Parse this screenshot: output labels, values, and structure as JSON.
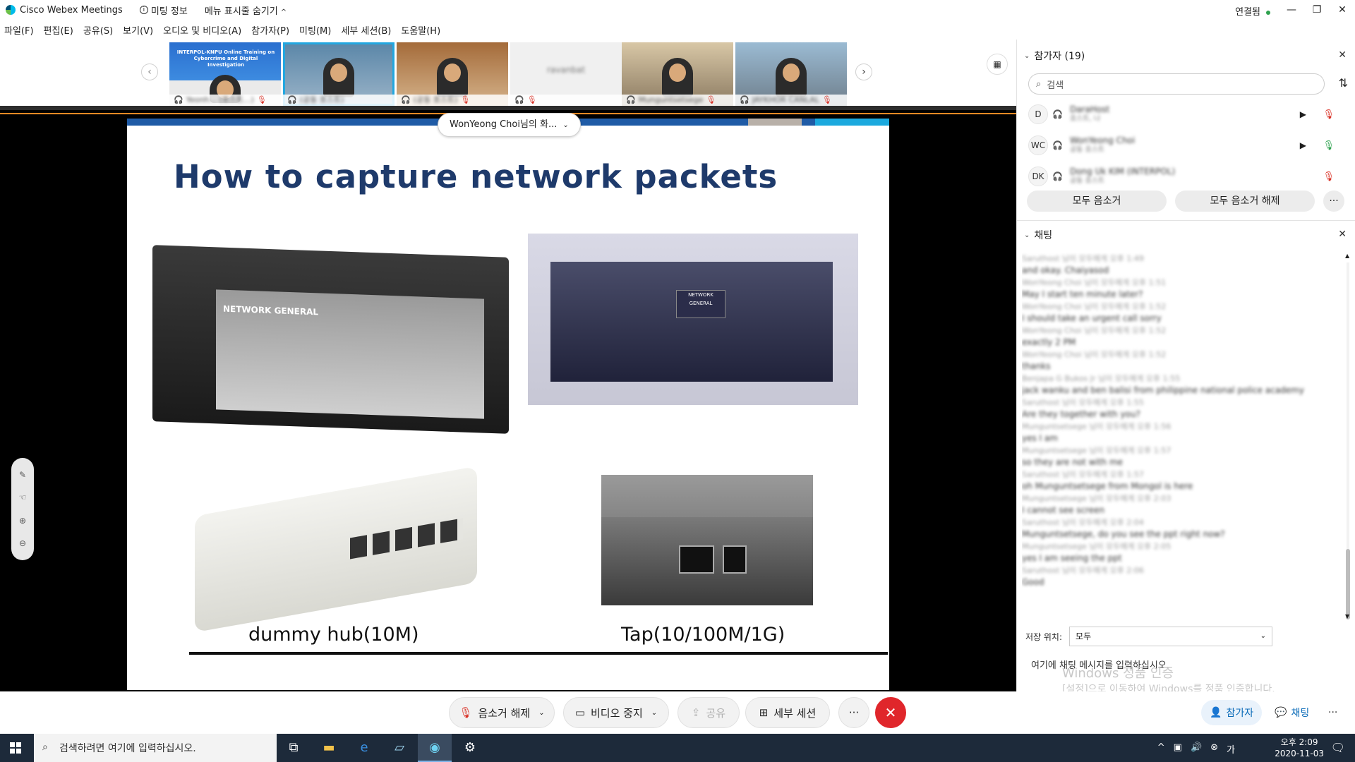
{
  "window": {
    "app_title": "Cisco Webex Meetings",
    "meeting_info": "미팅 정보",
    "hide_menu": "메뉴 표시줄 숨기기",
    "connection": "연결됨",
    "controls": {
      "minimize": "—",
      "restore": "❐",
      "close": "✕"
    }
  },
  "menu": {
    "items": [
      "파일(F)",
      "편집(E)",
      "공유(S)",
      "보기(V)",
      "오디오 및 비디오(A)",
      "참가자(P)",
      "미팅(M)",
      "세부 세션(B)",
      "도움말(H)"
    ]
  },
  "thumbnails": [
    {
      "label": "Yeonh... (호스트...)",
      "banner": "INTERPOL-KNPU Online Training on Cybercrime and Digital Investigation"
    },
    {
      "label": "(공동 호스트)"
    },
    {
      "label": "(공동 호스트)"
    },
    {
      "label": "ravanbat"
    },
    {
      "label": "Munguntsetsege"
    },
    {
      "label": "JAYKHOR CANLAL"
    }
  ],
  "share": {
    "presenter": "WonYeong Choi님의 화...",
    "slide": {
      "title": "How to capture network packets",
      "device1_brand": "NETWORK GENERAL",
      "device2_brand": "NETWORK GENERAL",
      "caption_left": "dummy hub(10M)",
      "caption_right": "Tap(10/100M/1G)"
    }
  },
  "toolbar": {
    "mute": "음소거 해제",
    "video": "비디오 중지",
    "share": "공유",
    "breakout": "세부 세션",
    "more": "···",
    "end": "✕",
    "participants": "참가자",
    "chat": "채팅",
    "panel_more": "···"
  },
  "participants_panel": {
    "title": "참가자 (19)",
    "search_placeholder": "검색",
    "rows": [
      {
        "initials": "D",
        "name": "DaraHost",
        "role": "호스트, 나"
      },
      {
        "initials": "WC",
        "name": "WonYeong Choi",
        "role": "공동 호스트"
      },
      {
        "initials": "DK",
        "name": "Dong Uk KIM (INTERPOL)",
        "role": "공동 호스트"
      }
    ],
    "mute_all": "모두 음소거",
    "unmute_all": "모두 음소거 해제",
    "more": "···"
  },
  "chat_panel": {
    "title": "채팅",
    "lines": [
      {
        "meta": "Saruthost 님이 모두에게 오후 1:49"
      },
      {
        "text": "and okay. Chaiyasod"
      },
      {
        "meta": "WonYeong Choi 님이 모두에게 오후 1:51"
      },
      {
        "text": "May I start ten minute later?"
      },
      {
        "meta": "WonYeong Choi 님이 모두에게 오후 1:52"
      },
      {
        "text": "I should take an urgent call sorry"
      },
      {
        "meta": "WonYeong Choi 님이 모두에게 오후 1:52"
      },
      {
        "text": "exactly 2 PM"
      },
      {
        "meta": "WonYeong Choi 님이 모두에게 오후 1:52"
      },
      {
        "text": "thanks"
      },
      {
        "meta": "Benjapa G Bukos Jr 님이 모두에게 오후 1:55"
      },
      {
        "text": "jack wanku and ben balisi from philippine national police academy"
      },
      {
        "meta": "Saruthost 님이 모두에게 오후 1:55"
      },
      {
        "text": "Are they together with you?"
      },
      {
        "meta": "Munguntsetsege 님이 모두에게 오후 1:56"
      },
      {
        "text": "yes I am"
      },
      {
        "meta": "Munguntsetsege 님이 모두에게 오후 1:57"
      },
      {
        "text": "so they are not with me"
      },
      {
        "meta": "Saruthost 님이 모두에게 오후 1:57"
      },
      {
        "text": "oh Munguntsetsege from Mongol is here"
      },
      {
        "meta": "Munguntsetsege 님이 모두에게 오후 2:03"
      },
      {
        "text": "I cannot see screen"
      },
      {
        "meta": "Saruthost 님이 모두에게 오후 2:04"
      },
      {
        "text": "Munguntsetsege, do you see the ppt right now?"
      },
      {
        "meta": "Munguntsetsege 님이 모두에게 오후 2:05"
      },
      {
        "text": " yes I am seeing the ppt"
      },
      {
        "meta": "Saruthost 님이 모두에게 오후 2:06"
      },
      {
        "text": "Good"
      }
    ],
    "save_label": "저장 위치:",
    "save_value": "모두",
    "input_placeholder": "여기에 채팅 메시지를 입력하십시오."
  },
  "watermark": {
    "line1": "Windows 정품 인증",
    "line2": "[설정]으로 이동하여 Windows를 정품 인증합니다."
  },
  "taskbar": {
    "search_placeholder": "검색하려면 여기에 입력하십시오.",
    "time": "오후 2:09",
    "date": "2020-11-03"
  },
  "colors": {
    "accent": "#22a7e0",
    "end_call": "#e0262b",
    "muted": "#d93025",
    "unmuted": "#2fa24f",
    "slide_title": "#1e3a6b"
  }
}
